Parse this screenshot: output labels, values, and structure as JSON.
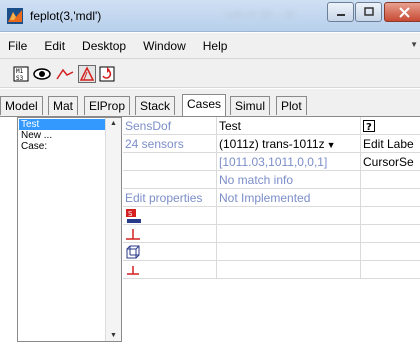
{
  "window": {
    "title": "feplot(3,'mdl')",
    "blurred_title": "calc.m 30 -- fe"
  },
  "menu": {
    "items": [
      "File",
      "Edit",
      "Desktop",
      "Window",
      "Help"
    ]
  },
  "toolbar": {
    "buttons": [
      {
        "name": "mesh-select-icon",
        "pressed": false
      },
      {
        "name": "eye-icon",
        "pressed": false
      },
      {
        "name": "line-peak-icon",
        "pressed": false
      },
      {
        "name": "delta-icon",
        "pressed": true
      },
      {
        "name": "refresh-icon",
        "pressed": false
      }
    ]
  },
  "tabs": [
    "Model",
    "Mat",
    "ElProp",
    "Stack",
    "Cases",
    "Simul",
    "Plot"
  ],
  "active_tab": "Cases",
  "left_list": {
    "items": [
      "Test",
      "New ...",
      "Case:"
    ],
    "selected": "Test"
  },
  "table": {
    "rows": [
      {
        "c1": "SensDof",
        "c2": "Test",
        "c3": "?",
        "c3_icon": "help-icon"
      },
      {
        "c1": "24 sensors",
        "c2": "(1011z) trans-1011z",
        "c2_dropdown": true,
        "c3": "Edit Labe"
      },
      {
        "c1": "",
        "c2": "[1011.03,1011,0,0,1]",
        "c3": "CursorSe"
      },
      {
        "c1": "",
        "c2": "No match info",
        "c3": ""
      },
      {
        "c1": "Edit properties",
        "c2": "Not Implemented",
        "c3": ""
      },
      {
        "c1": "",
        "c1_icon": "sensor-red-icon",
        "c2": "",
        "c3": ""
      },
      {
        "c1": "",
        "c1_icon": "red-t-icon",
        "c2": "",
        "c3": ""
      },
      {
        "c1": "",
        "c1_icon": "cube-icon",
        "c2": "",
        "c3": ""
      },
      {
        "c1": "",
        "c1_icon": "red-t-small-icon",
        "c2": "",
        "c3": ""
      }
    ]
  },
  "colors": {
    "accent": "#3399ff",
    "blue_text": "#7b8ec9",
    "red_icon": "#d42020"
  }
}
